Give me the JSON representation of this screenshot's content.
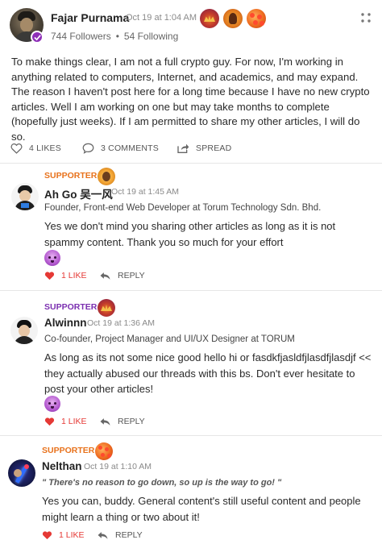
{
  "colors": {
    "supporter_orange": "#e8721c",
    "supporter_purple": "#7b2fb0",
    "like_red": "#e53935",
    "muted": "#8a8a8a"
  },
  "post": {
    "author": "Fajar Purnama",
    "time": "Oct 19 at 1:04 AM",
    "followers": "744 Followers",
    "separator": "•",
    "following": "54 Following",
    "body": "To make things clear, I am not a full crypto guy. For now, I'm working in anything related to computers, Internet, and academics, and may expand. The reason I haven't post here for a long time because I have no new crypto articles. Well I am working on one but may take months to complete (hopefully just weeks). If I am permitted to share my other articles, I will do so.",
    "likes": "4 LIKES",
    "comments": "3 COMMENTS",
    "spread": "SPREAD"
  },
  "comments": [
    {
      "role": "SUPPORTER",
      "name": "Ah Go 吴一风",
      "time": "Oct 19 at 1:45 AM",
      "title": "Founder, Front-end Web Developer at Torum Technology Sdn. Bhd.",
      "text": "Yes we don't mind you sharing other articles as long as it is not spammy content. Thank you so much for your effort",
      "like": "1 LIKE",
      "reply": "REPLY"
    },
    {
      "role": "SUPPORTER",
      "name": "Alwinnn",
      "time": "Oct 19 at 1:36 AM",
      "title": "Co-founder, Project Manager and UI/UX Designer at TORUM",
      "text": "As long as its not some nice good hello hi or fasdkfjasldfjlasdfjlasdjf << they actually abused our threads with this bs. Don't ever hesitate to post your other articles!",
      "like": "1 LIKE",
      "reply": "REPLY"
    },
    {
      "role": "SUPPORTER",
      "name": "Nelthan",
      "time": "Oct 19 at 1:10 AM",
      "quote": "\" There's no reason to go down, so up is the way to go! \"",
      "text": "Yes you can, buddy. General content's still useful content and people might learn a thing or two about it!",
      "like": "1 LIKE",
      "reply": "REPLY"
    }
  ]
}
